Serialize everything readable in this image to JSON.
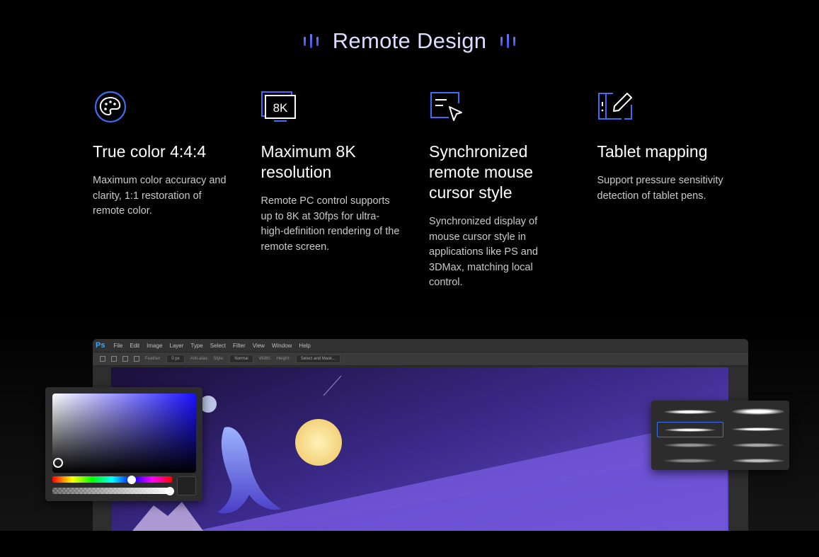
{
  "header": {
    "title": "Remote Design"
  },
  "features": [
    {
      "icon": "palette-icon",
      "title": "True color 4:4:4",
      "description": "Maximum color accuracy and clarity, 1:1 restoration of remote color."
    },
    {
      "icon": "8k-monitor-icon",
      "icon_text": "8K",
      "title": "Maximum 8K resolution",
      "description": "Remote PC control supports up to 8K at 30fps for ultra-high-definition rendering of the remote screen."
    },
    {
      "icon": "window-cursor-icon",
      "title": "Synchronized remote mouse cursor style",
      "description": "Synchronized display of mouse cursor style in applications like PS and 3DMax, matching local control."
    },
    {
      "icon": "tablet-pen-icon",
      "title": "Tablet mapping",
      "description": "Support pressure sensitivity detection of tablet pens."
    }
  ],
  "ps_window": {
    "logo": "Ps",
    "menu": [
      "File",
      "Edit",
      "Image",
      "Layer",
      "Type",
      "Select",
      "Filter",
      "View",
      "Window",
      "Help"
    ],
    "options": {
      "feather_label": "Feather:",
      "feather_value": "0 px",
      "antialias_label": "Anti-alias",
      "style_label": "Style:",
      "style_value": "Normal",
      "width_label": "Width:",
      "height_label": "Height:",
      "select_mask_label": "Select and Mask..."
    }
  },
  "colors": {
    "accent": "#3f6cf2",
    "title_bar": "#5b6cff",
    "background": "#000000"
  }
}
